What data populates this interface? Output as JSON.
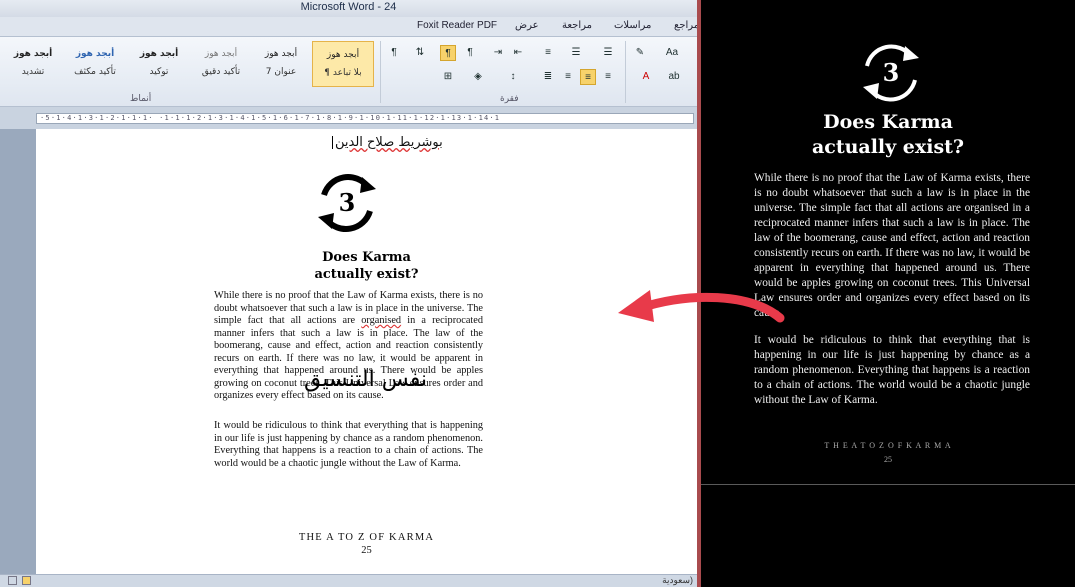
{
  "window": {
    "title": "Microsoft Word  -  24"
  },
  "ribbon": {
    "tabs": [
      "Foxit Reader PDF",
      "عرض",
      "مراجعة",
      "مراسلات",
      "مراجع"
    ],
    "styles": [
      {
        "sample": "أبجد هوز",
        "name": "تشديد"
      },
      {
        "sample": "أبجد هوز",
        "name": "تأكيد مكثف"
      },
      {
        "sample": "أبجد هوز",
        "name": "توكيد"
      },
      {
        "sample": "أبجد هوز",
        "name": "تأكيد دقيق"
      },
      {
        "sample": "أبجد هوز",
        "name": "عنوان 7"
      },
      {
        "sample": "أبجد هوز",
        "name": "¶ بلا تباعد"
      }
    ],
    "group_styles": "أنماط",
    "group_paragraph": "فقرة"
  },
  "ruler": {
    "ticks": "·5·1·4·1·3·1·2·1·1·1· ·1·1·1·2·1·3·1·4·1·5·1·6·1·7·1·8·1·9·1·10·1·11·1·12·1·13·1·14·1"
  },
  "status": {
    "language": "سعودية)"
  },
  "document": {
    "author": "بوشريط صلاح الدين",
    "chapter_number": "3",
    "title_line1": "Does Karma",
    "title_line2": "actually exist?",
    "para1_a": "While there is no proof that the Law of Karma exists, there is no doubt whatsoever that such a law is in place in the universe. The simple fact that all actions are ",
    "para1_red": "organised",
    "para1_b": " in a reciprocated manner infers that such a law is in place. The law of the boomerang, cause and effect, action and reaction consistently recurs on earth. If there was no law, it would be apparent in everything that happened around us. There would be apples growing on coconut trees. This Universal Law ensures order and organizes every effect based on its cause.",
    "para2": "It would be ridiculous to think that everything that is happening in our life is just happening by chance as a random phenomenon. Everything that happens is a reaction to a chain of actions. The world would be a chaotic jungle without the Law of Karma.",
    "overlay": "نفس التنسيق",
    "footer_title": "THE A TO Z OF KARMA",
    "page_number": "25"
  },
  "reference": {
    "chapter_number": "3",
    "title_line1": "Does Karma",
    "title_line2": "actually exist?",
    "para1": "While there is no proof that the Law of Karma exists, there is no doubt whatsoever that such a law is in place in the universe. The simple fact that all actions are organised in a reciprocated manner infers that such a law is in place. The law of the boomerang, cause and effect, action and reaction consistently recurs on earth. If there was no law, it would be apparent in everything that happened around us. There would be apples growing on coconut trees. This Universal Law ensures order and organizes every effect based on its cause.",
    "para2": "It would be ridiculous to think that everything that is happening in our life is just happening by chance as a random phenomenon. Everything that happens is a reaction to a chain of actions. The world would be a chaotic jungle without the Law of Karma.",
    "footer_title": "T H E   A   T O   Z   O F   K A R M A",
    "page_number": "25"
  },
  "colors": {
    "arrow": "#e83a4a",
    "divider": "#a94b4e",
    "dark_bg": "#000000"
  }
}
